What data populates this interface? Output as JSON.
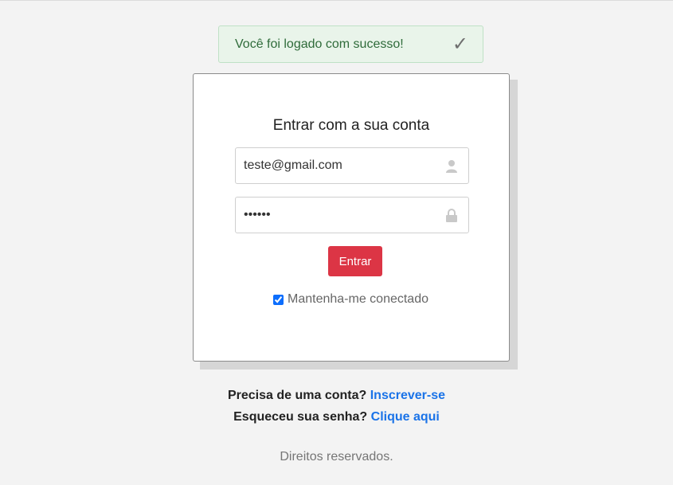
{
  "alert": {
    "message": "Você foi logado com sucesso!",
    "icon": "check-icon",
    "glyph": "✓"
  },
  "login": {
    "title": "Entrar com a sua conta",
    "email_value": "teste@gmail.com",
    "password_value": "••••••",
    "email_icon": "user-icon",
    "password_icon": "lock-icon",
    "submit_label": "Entrar",
    "remember_label": "Mantenha-me conectado",
    "remember_checked": true
  },
  "footer": {
    "signup_prompt": "Precisa de uma conta?",
    "signup_link": "Inscrever-se",
    "forgot_prompt": "Esqueceu sua senha?",
    "forgot_link": "Clique aqui",
    "copyright": "Direitos reservados."
  },
  "colors": {
    "background": "#f3f3f3",
    "alert_bg": "#e9f4ea",
    "alert_text": "#2f6b3a",
    "button": "#dc3545",
    "link": "#1a73e8"
  }
}
